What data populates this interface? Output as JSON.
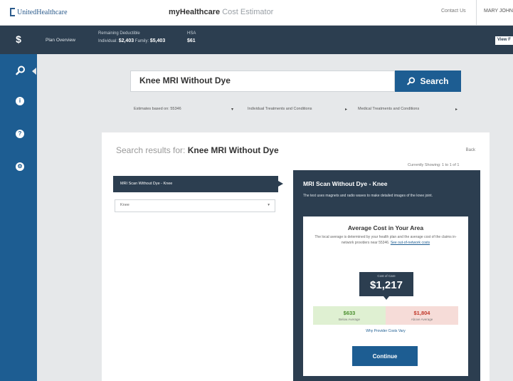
{
  "header": {
    "logo_text": "UnitedHealthcare",
    "app_title_bold": "myHealthcare",
    "app_title_light": "Cost Estimator",
    "contact_us": "Contact Us",
    "user_name": "MARY JOHNSON"
  },
  "balances": {
    "plan_overview": "Plan Overview",
    "deductible_label": "Remaining Deductible",
    "individual_label": "Individual:",
    "individual_value": "$2,403",
    "family_label": "Family:",
    "family_value": "$5,403",
    "hsa_label": "HSA",
    "hsa_value": "$61",
    "view_button": "View F"
  },
  "sidebar": {
    "dollar": "$",
    "items": [
      "search-icon",
      "info-icon",
      "help-icon",
      "settings-icon"
    ]
  },
  "search": {
    "query": "Knee MRI Without Dye",
    "button_label": "Search",
    "filters": [
      "Estimates based on: 55346",
      "Individual Treatments and Conditions",
      "Medical Treatments and Conditions"
    ]
  },
  "results": {
    "label": "Search results for:",
    "query": "Knee MRI Without Dye",
    "back": "Back",
    "showing": "Currently Showing: 1 to 1 of 1",
    "item": "MRI Scan Without Dye - Knee",
    "location_select": "Knee"
  },
  "detail": {
    "title": "MRI Scan Without Dye - Knee",
    "description": "The test uses magnets and radio waves to make detailed images of the knee joint.",
    "card_title": "Average Cost in Your Area",
    "card_description": "The local average is determined by your health plan and the average cost of the claims in-network providers near 55346.",
    "card_link": "See out-of-network costs",
    "price_label": "Cost of Care",
    "price": "$1,217",
    "low_value": "$633",
    "low_label": "Below Average",
    "high_value": "$1,804",
    "high_label": "Above Average",
    "why_link": "Why Provider Costs Vary",
    "continue_button": "Continue"
  },
  "colors": {
    "navy": "#2c3e50",
    "brand_blue": "#1d5d92",
    "low_green": "#4a8f2e",
    "high_red": "#c0392b"
  }
}
